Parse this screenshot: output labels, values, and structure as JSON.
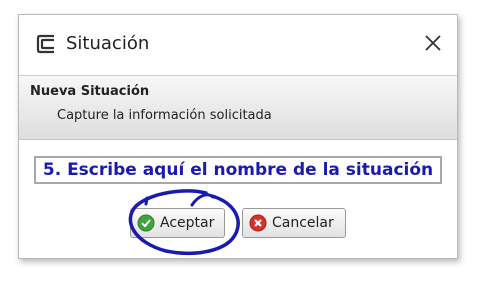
{
  "dialog": {
    "title": "Situación",
    "app_icon": "window-frame-icon",
    "close_icon": "close-icon"
  },
  "header": {
    "title": "Nueva Situación",
    "subtitle": "Capture la información solicitada"
  },
  "form": {
    "name_placeholder": "5. Escribe aquí el nombre de la situación",
    "name_value": ""
  },
  "buttons": {
    "ok_label": "Aceptar",
    "ok_icon": "check-circle-icon",
    "cancel_label": "Cancelar",
    "cancel_icon": "x-circle-icon"
  },
  "colors": {
    "annotation": "#1a1ab0",
    "ok_green": "#3ea53e",
    "cancel_red": "#d9302c"
  }
}
